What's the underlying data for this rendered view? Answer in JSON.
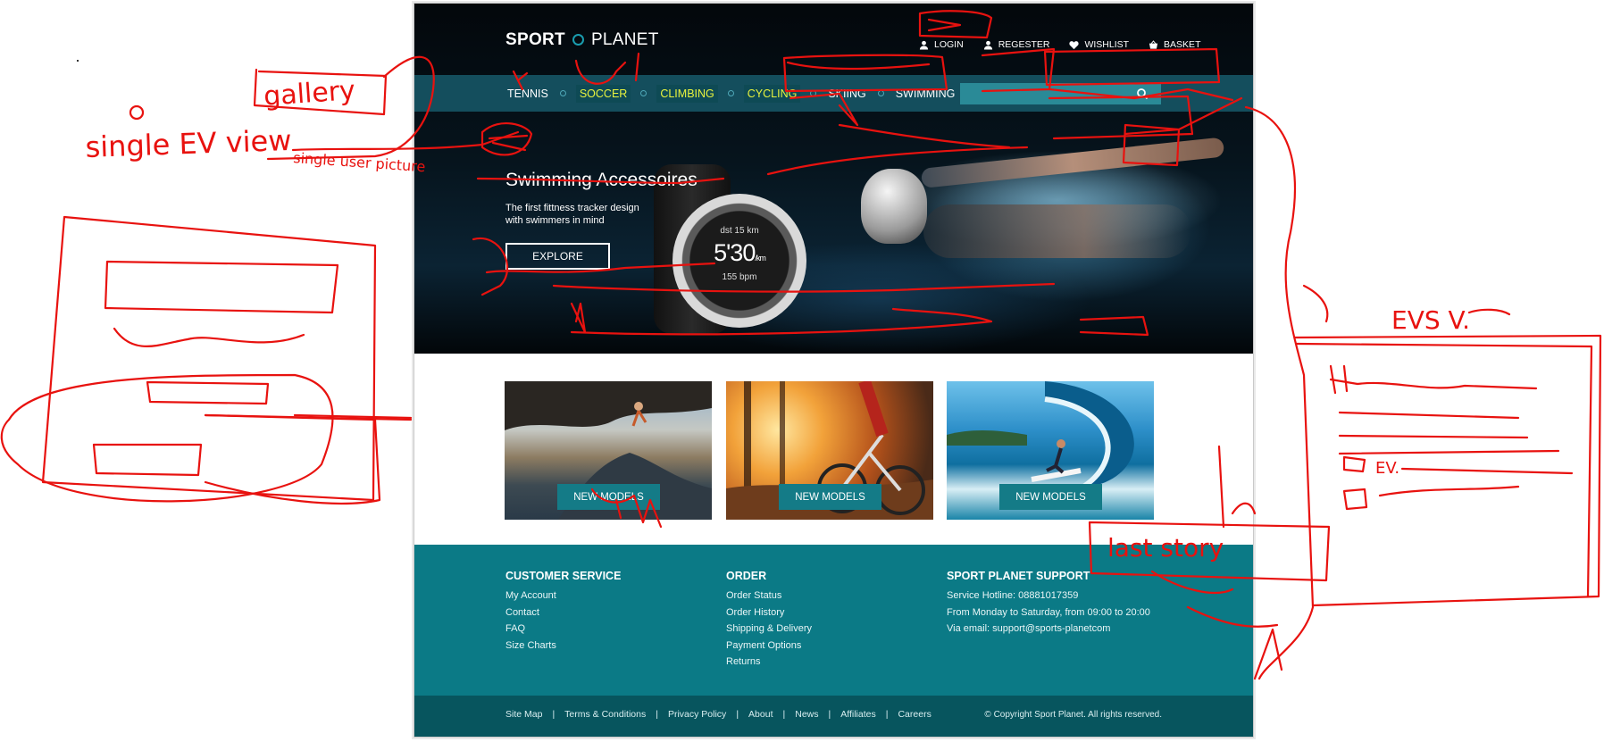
{
  "site": {
    "logo": {
      "sport": "SPORT",
      "planet": "PLANET"
    },
    "user_links": [
      {
        "label": "LOGIN",
        "icon": "user-icon"
      },
      {
        "label": "REGESTER",
        "icon": "user-icon"
      },
      {
        "label": "WISHLIST",
        "icon": "heart-icon"
      },
      {
        "label": "BASKET",
        "icon": "basket-icon"
      }
    ],
    "nav": [
      {
        "label": "TENNIS",
        "highlight": false
      },
      {
        "label": "SOCCER",
        "highlight": true
      },
      {
        "label": "CLIMBING",
        "highlight": true
      },
      {
        "label": "CYCLING",
        "highlight": true
      },
      {
        "label": "SKIING",
        "highlight": false
      },
      {
        "label": "SWIMMING",
        "highlight": false
      }
    ],
    "search": {
      "placeholder": "",
      "icon": "search-icon"
    },
    "hero": {
      "title": "Swimming Accessoires",
      "subtitle": "The first fittness tracker design with swimmers in mind",
      "button": "EXPLORE",
      "watch": {
        "distance": "dst 15 km",
        "time": "5'30",
        "pace_unit": "/km",
        "heart": "155 bpm"
      }
    },
    "tiles": [
      {
        "button": "NEW MODELS",
        "scene": "climbing"
      },
      {
        "button": "NEW MODELS",
        "scene": "cycling"
      },
      {
        "button": "NEW MODELS",
        "scene": "surfing"
      }
    ],
    "footer": {
      "customer_service": {
        "title": "CUSTOMER SERVICE",
        "links": [
          "My Account",
          "Contact",
          "FAQ",
          "Size Charts"
        ]
      },
      "order": {
        "title": "ORDER",
        "links": [
          "Order Status",
          "Order History",
          "Shipping & Delivery",
          "Payment Options",
          "Returns"
        ]
      },
      "support": {
        "title": "SPORT PLANET SUPPORT",
        "lines": [
          "Service Hotline: 08881017359",
          "From Monday to Saturday, from 09:00 to 20:00",
          "Via email: support@sports-planetcom"
        ]
      }
    },
    "subfooter": {
      "links": [
        "Site Map",
        "Terms & Conditions",
        "Privacy Policy",
        "About",
        "News",
        "Affiliates",
        "Careers"
      ],
      "copyright": "© Copyright Sport Planet. All rights reserved."
    }
  },
  "annotations": {
    "ink_color": "#e8120f",
    "labels": [
      "gallery",
      "single user picture",
      "single EV view",
      "EVS V.",
      "EV.",
      "last story"
    ]
  },
  "colors": {
    "teal": "#0b7a86",
    "teal_dark": "#07555e",
    "nav_bg": "#165464",
    "highlight_text": "#e8f33e"
  }
}
